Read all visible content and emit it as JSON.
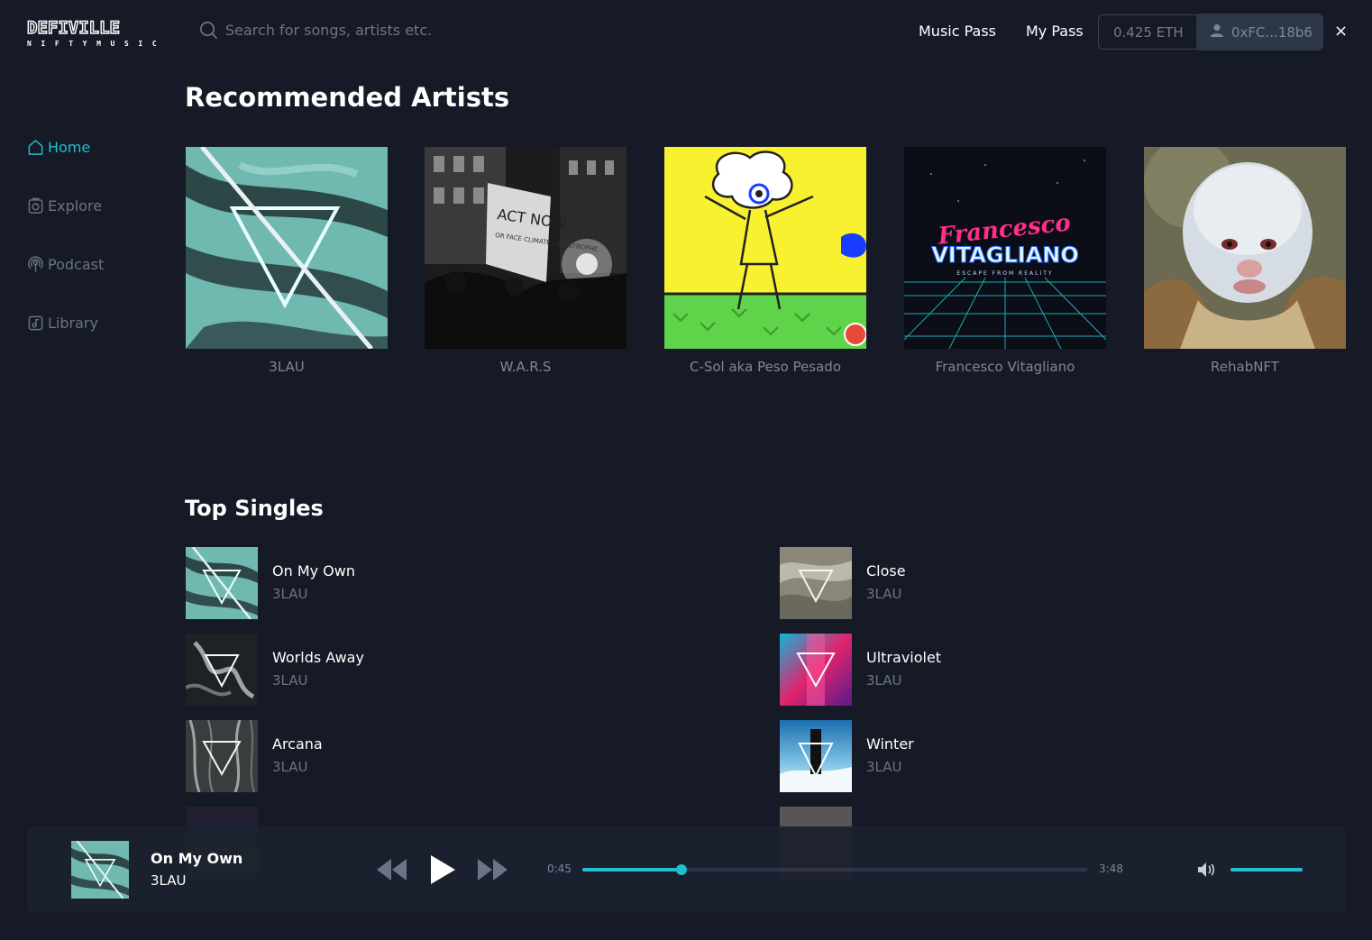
{
  "brand": {
    "name": "DEFIVILLE",
    "tagline": "NIFTYMUSIC"
  },
  "search": {
    "placeholder": "Search for songs, artists etc."
  },
  "header": {
    "music_pass": "Music Pass",
    "my_pass": "My Pass",
    "balance": "0.425 ETH",
    "wallet": "0xFC...18b6",
    "close": "×"
  },
  "sidebar": {
    "items": [
      {
        "label": "Home",
        "icon": "home-icon",
        "active": true
      },
      {
        "label": "Explore",
        "icon": "explore-icon",
        "active": false
      },
      {
        "label": "Podcast",
        "icon": "podcast-icon",
        "active": false
      },
      {
        "label": "Library",
        "icon": "library-icon",
        "active": false
      }
    ]
  },
  "recommended": {
    "title": "Recommended Artists",
    "artists": [
      {
        "name": "3LAU"
      },
      {
        "name": "W.A.R.S"
      },
      {
        "name": "C-Sol aka Peso Pesado"
      },
      {
        "name": "Francesco Vitagliano"
      },
      {
        "name": "RehabNFT"
      }
    ],
    "cover_text": {
      "protest_sign": "ACT NOW",
      "protest_sub": "OR FACE CLIMATE CATASTROPHE",
      "francesco_script": "Francesco",
      "francesco_main": "VITAGLIANO",
      "francesco_sub": "ESCAPE FROM REALITY"
    }
  },
  "top_singles": {
    "title": "Top Singles",
    "items": [
      {
        "title": "On My Own",
        "artist": "3LAU"
      },
      {
        "title": "Close",
        "artist": "3LAU"
      },
      {
        "title": "Worlds Away",
        "artist": "3LAU"
      },
      {
        "title": "Ultraviolet",
        "artist": "3LAU"
      },
      {
        "title": "Arcana",
        "artist": "3LAU"
      },
      {
        "title": "Winter",
        "artist": "3LAU"
      }
    ]
  },
  "player": {
    "title": "On My Own",
    "artist": "3LAU",
    "elapsed": "0:45",
    "duration": "3:48",
    "progress": 0.197,
    "volume": 1.0
  },
  "colors": {
    "accent": "#1fbfd0",
    "background": "#151a26",
    "muted": "#6b7386"
  }
}
